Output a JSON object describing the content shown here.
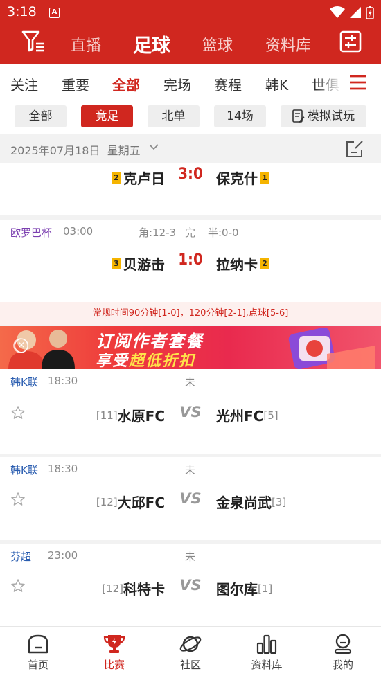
{
  "status_bar": {
    "time": "3:18",
    "app_badge": "A"
  },
  "header": {
    "tabs": [
      {
        "label": "直播",
        "active": false
      },
      {
        "label": "足球",
        "active": true
      },
      {
        "label": "篮球",
        "active": false
      },
      {
        "label": "资料库",
        "active": false
      }
    ],
    "filter_icon": "filter-icon",
    "settings_icon": "sliders-icon"
  },
  "category_tabs": [
    {
      "label": "关注",
      "active": false
    },
    {
      "label": "重要",
      "active": false
    },
    {
      "label": "全部",
      "active": true
    },
    {
      "label": "完场",
      "active": false
    },
    {
      "label": "赛程",
      "active": false
    },
    {
      "label": "韩K",
      "active": false
    },
    {
      "label": "世俱",
      "active": false
    }
  ],
  "filter_chips": [
    {
      "label": "全部",
      "active": false
    },
    {
      "label": "竞足",
      "active": true
    },
    {
      "label": "北单",
      "active": false
    },
    {
      "label": "14场",
      "active": false
    },
    {
      "label": "模拟试玩",
      "active": false
    }
  ],
  "date_bar": {
    "date": "2025年07月18日",
    "weekday": "星期五"
  },
  "matches": [
    {
      "home": "克卢日",
      "home_rank": "2",
      "score": "3:0",
      "away": "保克什",
      "away_rank": "1"
    },
    {
      "league": "欧罗巴杯",
      "league_color": "#7b3fb0",
      "time": "03:00",
      "extra": "角:12-3",
      "status": "完",
      "half": "半:0-0",
      "home": "贝游击",
      "home_rank": "3",
      "score": "1:0",
      "away": "拉纳卡",
      "away_rank": "2",
      "note": "常规时间90分钟[1-0]，120分钟[2-1],点球[5-6]"
    },
    {
      "league": "韩K联",
      "league_color": "#2a5db0",
      "time": "18:30",
      "status": "未",
      "home": "水原FC",
      "home_rank": "[11]",
      "vs": "VS",
      "away": "光州FC",
      "away_rank": "[5]"
    },
    {
      "league": "韩K联",
      "league_color": "#2a5db0",
      "time": "18:30",
      "status": "未",
      "home": "大邱FC",
      "home_rank": "[12]",
      "vs": "VS",
      "away": "金泉尚武",
      "away_rank": "[3]"
    },
    {
      "league": "芬超",
      "league_color": "#2a5db0",
      "time": "23:00",
      "status": "未",
      "home": "科特卡",
      "home_rank": "[12]",
      "vs": "VS",
      "away": "图尔库",
      "away_rank": "[1]"
    }
  ],
  "banner": {
    "line1": "订阅作者套餐",
    "line2_prefix": "享受",
    "line2_highlight": "超低折扣"
  },
  "bottom_nav": [
    {
      "label": "首页",
      "icon": "home-icon",
      "active": false
    },
    {
      "label": "比赛",
      "icon": "trophy-icon",
      "active": true
    },
    {
      "label": "社区",
      "icon": "planet-icon",
      "active": false
    },
    {
      "label": "资料库",
      "icon": "bar-chart-icon",
      "active": false
    },
    {
      "label": "我的",
      "icon": "user-icon",
      "active": false
    }
  ],
  "colors": {
    "brand_red": "#d0271f",
    "rank_yellow": "#f5b400"
  }
}
